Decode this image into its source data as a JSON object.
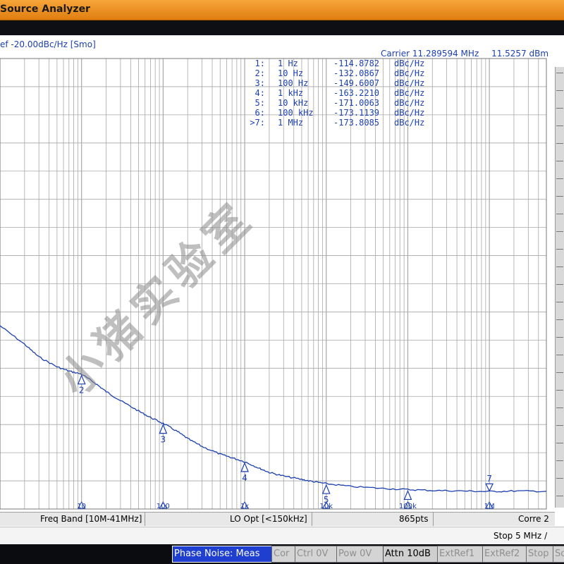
{
  "window": {
    "title": "Source Analyzer"
  },
  "header": {
    "ref_text": "ef -20.00dBc/Hz [Smo]",
    "carrier_label": "Carrier 11.289594 MHz",
    "carrier_power": "11.5257 dBm"
  },
  "marker_table": [
    {
      "id": "1:",
      "freq": "1 Hz",
      "value": "-114.8782",
      "unit": "dBc/Hz"
    },
    {
      "id": "2:",
      "freq": "10 Hz",
      "value": "-132.0867",
      "unit": "dBc/Hz"
    },
    {
      "id": "3:",
      "freq": "100 Hz",
      "value": "-149.6007",
      "unit": "dBc/Hz"
    },
    {
      "id": "4:",
      "freq": "1 kHz",
      "value": "-163.2210",
      "unit": "dBc/Hz"
    },
    {
      "id": "5:",
      "freq": "10 kHz",
      "value": "-171.0063",
      "unit": "dBc/Hz"
    },
    {
      "id": "6:",
      "freq": "100 kHz",
      "value": "-173.1139",
      "unit": "dBc/Hz"
    },
    {
      "id": ">7:",
      "freq": "1 MHz",
      "value": "-173.8085",
      "unit": "dBc/Hz"
    }
  ],
  "chart_data": {
    "type": "line",
    "title": "",
    "xlabel": "",
    "ylabel": "",
    "x_scale": "log",
    "y_unit": "dBc/Hz",
    "xlim": [
      1,
      5000000
    ],
    "ylim": [
      -180,
      -20
    ],
    "grid": true,
    "x_tick_labels": [
      "10",
      "100",
      "1k",
      "10k",
      "100k",
      "1M"
    ],
    "x_tick_values": [
      10,
      100,
      1000,
      10000,
      100000,
      1000000
    ],
    "series": [
      {
        "x": [
          1,
          2,
          3,
          5,
          7,
          10,
          15,
          20,
          30,
          50,
          70,
          100,
          150,
          200,
          300,
          500,
          700,
          1000,
          1500,
          2000,
          3000,
          5000,
          7000,
          10000,
          20000,
          50000,
          100000,
          200000,
          500000,
          1000000,
          2000000,
          5000000
        ],
        "y": [
          -114.9,
          -121.5,
          -126.0,
          -129.5,
          -131.0,
          -132.1,
          -135.5,
          -138.3,
          -141.5,
          -145.2,
          -147.5,
          -149.6,
          -152.5,
          -155.0,
          -157.8,
          -160.5,
          -161.8,
          -163.2,
          -165.5,
          -167.0,
          -168.3,
          -169.5,
          -170.3,
          -171.0,
          -172.0,
          -172.7,
          -173.1,
          -173.4,
          -173.6,
          -173.8,
          -173.6,
          -173.7
        ]
      }
    ],
    "markers": [
      {
        "label": "2",
        "x": 10,
        "y": -132.1
      },
      {
        "label": "3",
        "x": 100,
        "y": -149.6
      },
      {
        "label": "4",
        "x": 1000,
        "y": -163.2
      },
      {
        "label": "5",
        "x": 10000,
        "y": -171.0
      },
      {
        "label": "6",
        "x": 100000,
        "y": -173.1
      },
      {
        "label": "7",
        "x": 1000000,
        "y": -173.8
      }
    ],
    "colors": {
      "trace": "#1b3fb0",
      "grid": "#a8a8a8"
    }
  },
  "info_bar": {
    "freq_band": "Freq Band [10M-41MHz]",
    "lo_opt": "LO Opt [<150kHz]",
    "points": "865pts",
    "corre": "Corre 2"
  },
  "stop": {
    "label": "Stop 5 MHz",
    "suffix": "/"
  },
  "status_bar": {
    "phase_noise": "Phase Noise: Meas",
    "cor": "Cor",
    "ctrl": "Ctrl  0V",
    "pow": "Pow  0V",
    "attn": "Attn 10dB",
    "extref1": "ExtRef1",
    "extref2": "ExtRef2",
    "stop": "Stop",
    "sc": "Sc"
  },
  "watermark": "小猪实验室"
}
